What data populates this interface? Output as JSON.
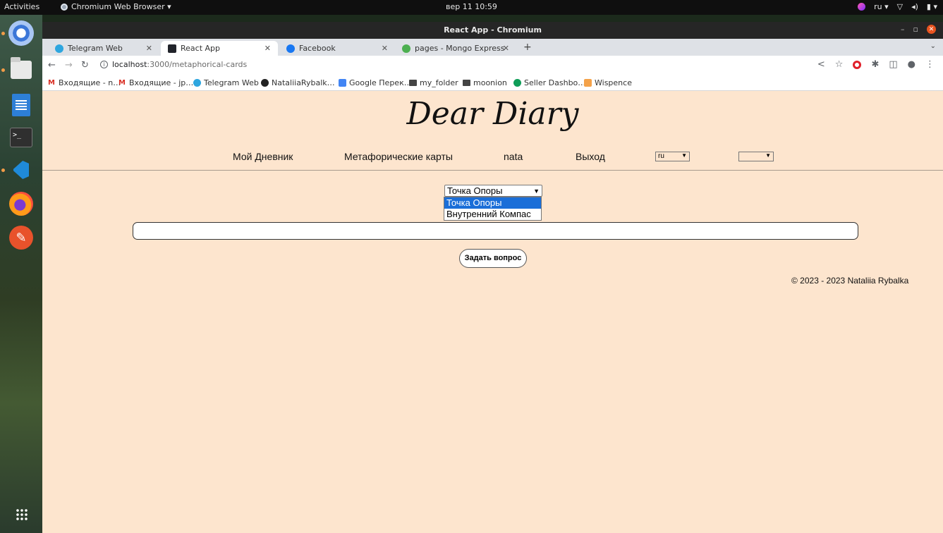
{
  "system": {
    "activities": "Activities",
    "app_name": "Chromium Web Browser ▾",
    "clock": "вер 11  10:59",
    "lang": "ru ▾"
  },
  "window": {
    "title": "React App - Chromium"
  },
  "tabs": [
    {
      "label": "Telegram Web",
      "color": "#2ea6df"
    },
    {
      "label": "React App",
      "color": "#20232a"
    },
    {
      "label": "Facebook",
      "color": "#1877f2"
    },
    {
      "label": "pages - Mongo Express",
      "color": "#4caf50"
    }
  ],
  "toolbar": {
    "url_host": "localhost",
    "url_path": ":3000/metaphorical-cards"
  },
  "bookmarks": [
    {
      "label": "Входящие - n…",
      "icon": "gmail-icon"
    },
    {
      "label": "Входящие - jp…",
      "icon": "gmail-icon"
    },
    {
      "label": "Telegram Web",
      "icon": "telegram-icon"
    },
    {
      "label": "NataliiaRybalk…",
      "icon": "github-icon"
    },
    {
      "label": "Google Перек…",
      "icon": "translate-icon"
    },
    {
      "label": "my_folder",
      "icon": "folder-icon"
    },
    {
      "label": "moonion",
      "icon": "folder-icon"
    },
    {
      "label": "Seller Dashbo…",
      "icon": "seller-icon"
    },
    {
      "label": "Wispence",
      "icon": "wispence-icon"
    }
  ],
  "page": {
    "brand": "Dear Diary",
    "nav": {
      "diary": "Мой Дневник",
      "cards": "Метафорические карты",
      "user": "nata",
      "logout": "Выход",
      "lang_value": "ru",
      "second_value": ""
    },
    "card_select": {
      "value": "Точка Опоры",
      "options": [
        "Точка Опоры",
        "Внутренний Компас"
      ]
    },
    "question": {
      "value": ""
    },
    "ask_button": "Задать вопрос",
    "footer": "© 2023 - 2023 Nataliia Rybalka"
  }
}
